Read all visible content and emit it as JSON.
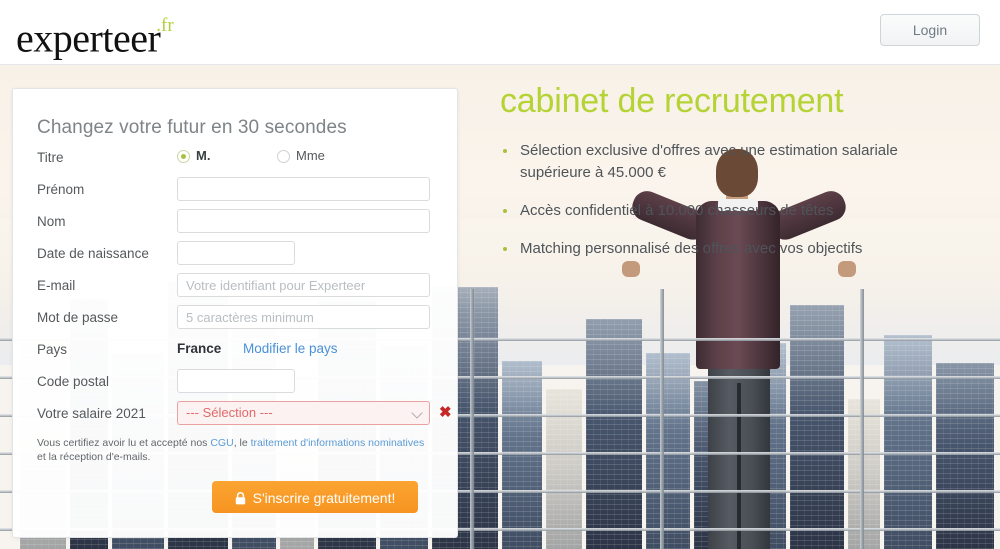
{
  "header": {
    "logo_name": "experteer",
    "logo_tld": ".fr",
    "login_label": "Login"
  },
  "form": {
    "title": "Changez votre futur en 30 secondes",
    "fields": {
      "title_label": "Titre",
      "title_option_male": "M.",
      "title_option_female": "Mme",
      "firstname_label": "Prénom",
      "firstname_value": "",
      "firstname_placeholder": "",
      "lastname_label": "Nom",
      "lastname_value": "",
      "lastname_placeholder": "",
      "birthdate_label": "Date de naissance",
      "birthdate_value": "",
      "birthdate_placeholder": "",
      "email_label": "E-mail",
      "email_value": "",
      "email_placeholder": "Votre identifiant pour Experteer",
      "password_label": "Mot de passe",
      "password_value": "",
      "password_placeholder": "5 caractères minimum",
      "country_label": "Pays",
      "country_value": "France",
      "country_change_link": "Modifier le pays",
      "postcode_label": "Code postal",
      "postcode_value": "",
      "postcode_placeholder": "",
      "salary_label": "Votre salaire 2021",
      "salary_selected": "--- Sélection ---",
      "salary_error_mark": "✖"
    },
    "legal": {
      "part1": "Vous certifiez avoir lu et accepté nos ",
      "link1": "CGU",
      "part2": ", le ",
      "link2": "traitement d'informations nominatives",
      "part3": " et la réception d'e-mails."
    },
    "submit_label": "S'inscrire gratuitement!"
  },
  "promo": {
    "title": "cabinet de recrutement",
    "bullets": [
      "Sélection exclusive d'offres avec une estimation salariale supérieure à 45.000 €",
      "Accès confidentiel à 10.000 chasseurs de têtes",
      "Matching personnalisé des offres avec vos objectifs"
    ]
  },
  "colors": {
    "brand_green": "#b5d334",
    "accent_orange": "#f79421",
    "link_blue": "#4a90d9",
    "error_red": "#c62828"
  }
}
